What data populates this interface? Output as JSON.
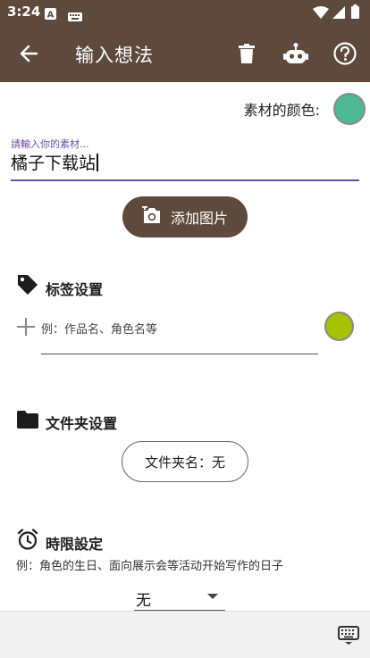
{
  "status_bar": {
    "time": "3:24",
    "icons": [
      "notification-a-icon",
      "keyboard-status-icon",
      "wifi-icon",
      "signal-icon",
      "battery-icon"
    ]
  },
  "appbar": {
    "title": "输入想法",
    "icons": [
      "back-arrow-icon",
      "delete-icon",
      "robot-icon",
      "help-icon"
    ]
  },
  "material_color": {
    "label": "素材的颜色:",
    "color": "#4db892"
  },
  "material_input": {
    "label": "請輸入你的素材...",
    "value": "橘子下载站"
  },
  "add_image": {
    "label": "添加图片"
  },
  "tags": {
    "title": "标签设置",
    "hint": "例：作品名、角色名等",
    "color": "#a6c200"
  },
  "folder": {
    "title": "文件夹设置",
    "button_label": "文件夹名：无"
  },
  "deadline": {
    "title": "時限設定",
    "example": "例：角色的生日、面向展示会等活动开始写作的日子",
    "select_value": "无"
  },
  "colors": {
    "primary": "#5d4a3c",
    "accent": "#6a4fa8"
  }
}
